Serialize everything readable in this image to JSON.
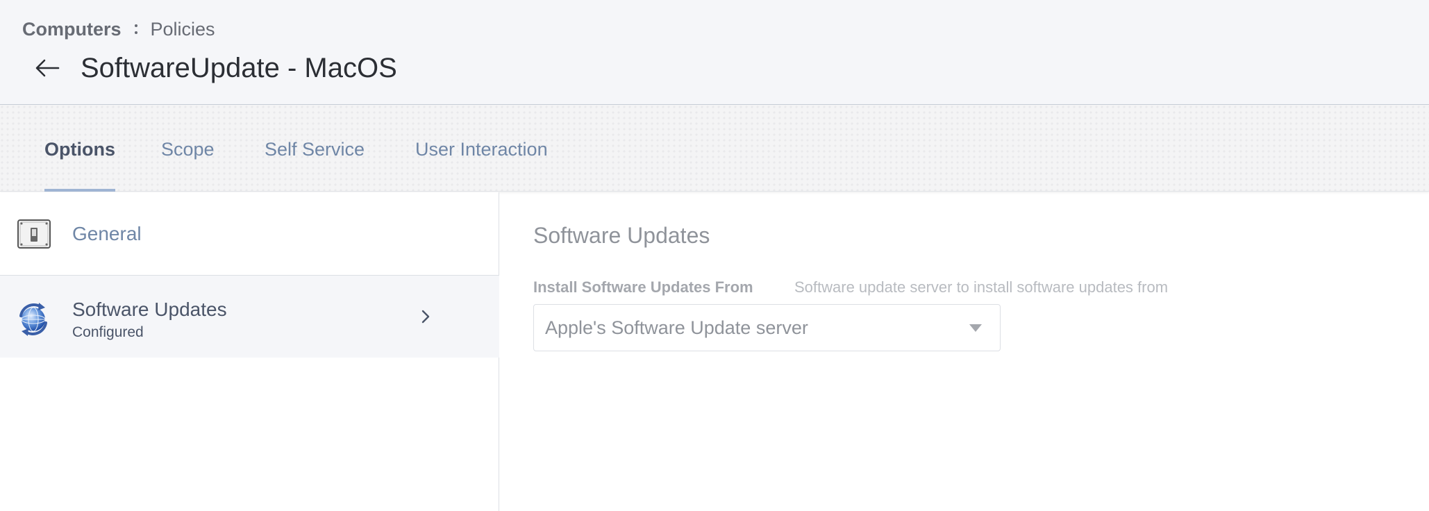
{
  "breadcrumb": {
    "parent": "Computers",
    "current": "Policies"
  },
  "page": {
    "title": "SoftwareUpdate - MacOS"
  },
  "tabs": [
    {
      "label": "Options",
      "active": true
    },
    {
      "label": "Scope",
      "active": false
    },
    {
      "label": "Self Service",
      "active": false
    },
    {
      "label": "User Interaction",
      "active": false
    }
  ],
  "sidebar": {
    "items": [
      {
        "label": "General",
        "icon": "toggle-switch-icon"
      },
      {
        "label": "Software Updates",
        "status": "Configured",
        "icon": "software-update-globe-icon"
      }
    ]
  },
  "content": {
    "title": "Software Updates",
    "field": {
      "label": "Install Software Updates From",
      "help": "Software update server to install software updates from",
      "value": "Apple's Software Update server"
    }
  },
  "colors": {
    "header_bg": "#f5f6f9",
    "tab_text": "#6f86a6",
    "tab_active_underline": "#9fb4d3",
    "sidebar_selected_bg": "#f5f6f9"
  }
}
